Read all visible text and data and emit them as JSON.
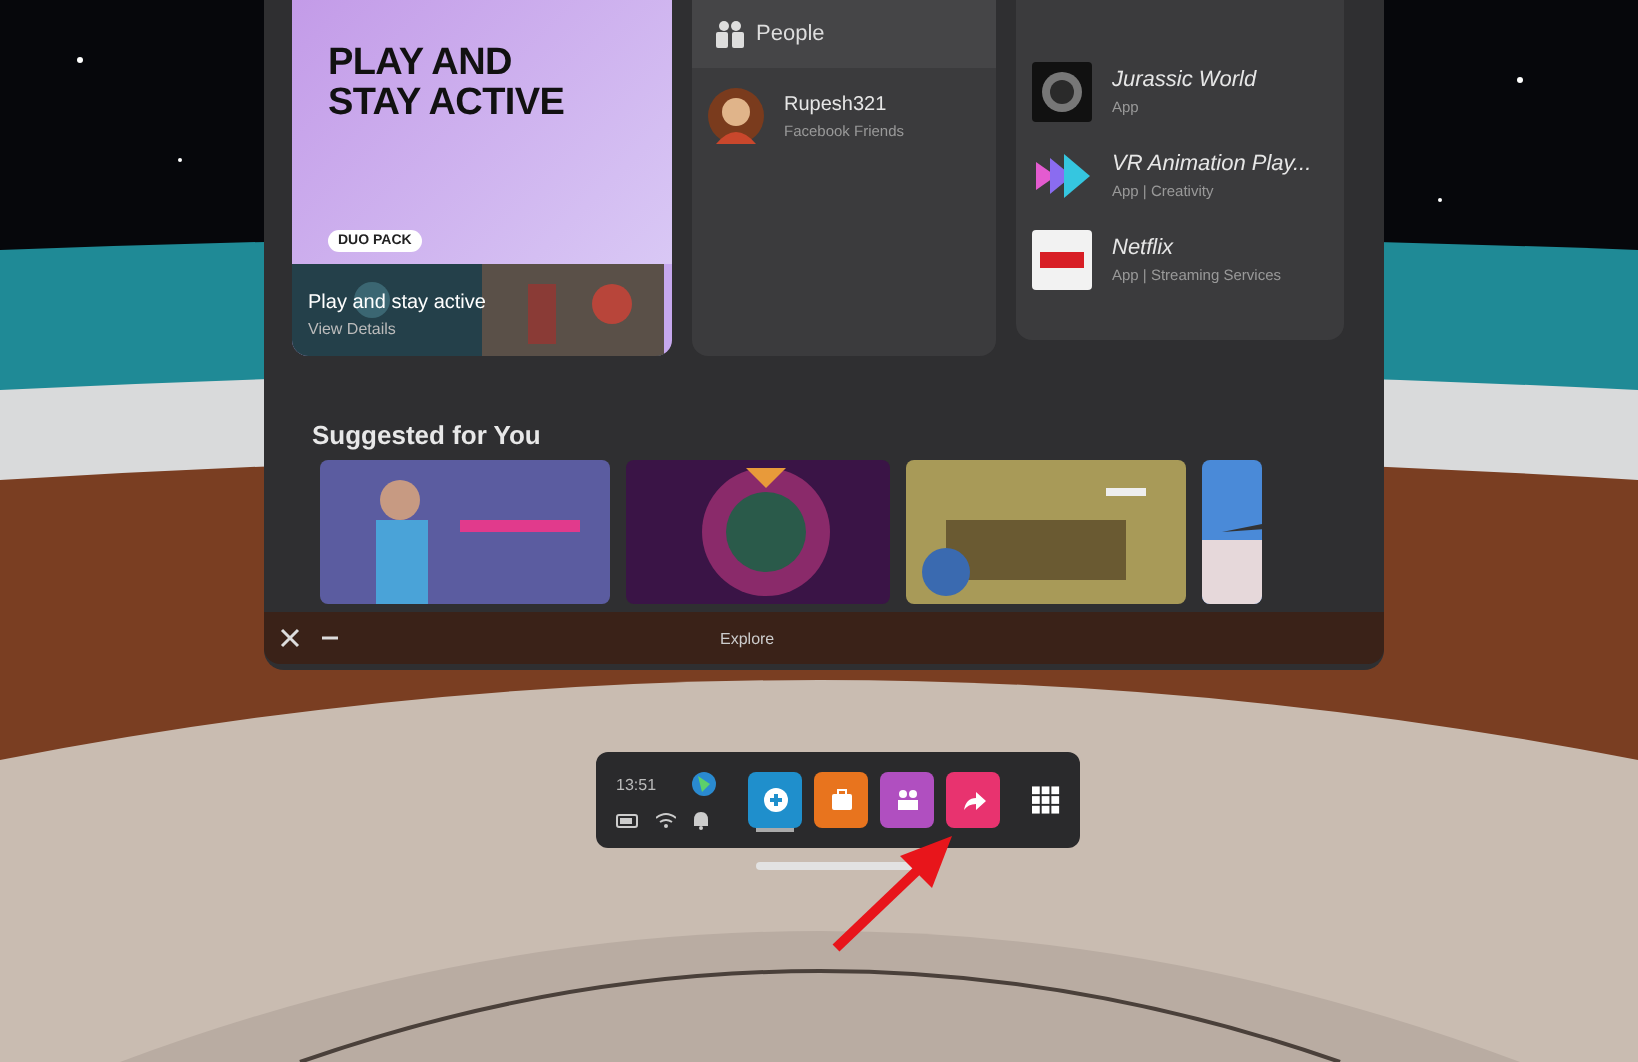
{
  "promo": {
    "headline": "PLAY AND STAY ACTIVE",
    "badge": "DUO PACK",
    "title": "Play and stay active",
    "link": "View Details"
  },
  "people": {
    "header": "People",
    "items": [
      {
        "name": "Rupesh321",
        "subtitle": "Facebook Friends"
      }
    ]
  },
  "apps": {
    "items": [
      {
        "name": "Jurassic World",
        "subtitle": "App",
        "kind": "dark"
      },
      {
        "name": "VR Animation Play...",
        "subtitle": "App | Creativity",
        "kind": "arrows"
      },
      {
        "name": "Netflix",
        "subtitle": "App | Streaming Services",
        "kind": "red"
      }
    ]
  },
  "suggested": {
    "title": "Suggested for You"
  },
  "window_bar": {
    "title": "Explore"
  },
  "taskbar": {
    "time": "13:51",
    "apps": [
      {
        "kind": "plus",
        "color": "#1f8fcc",
        "selected": true
      },
      {
        "kind": "bag",
        "color": "#e8741e",
        "selected": false
      },
      {
        "kind": "people",
        "color": "#b04fc0",
        "selected": false
      },
      {
        "kind": "share",
        "color": "#e8336f",
        "selected": false
      }
    ]
  }
}
